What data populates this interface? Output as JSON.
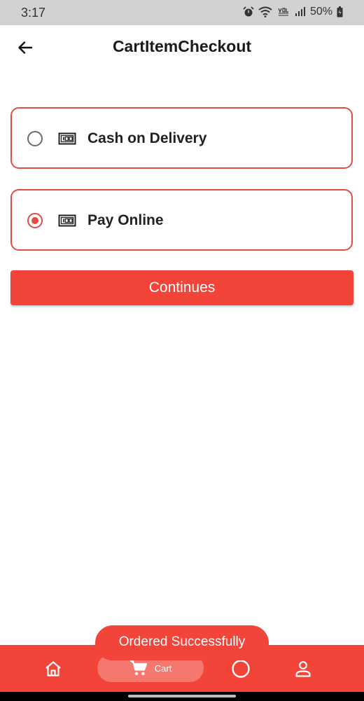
{
  "status_bar": {
    "time": "3:17",
    "battery": "50%",
    "icons": [
      "alarm-icon",
      "wifi-icon",
      "volte-icon",
      "signal-icon",
      "battery-icon"
    ]
  },
  "app_bar": {
    "title": "CartItemCheckout",
    "back_icon": "arrow-back-icon"
  },
  "payment_options": [
    {
      "label": "Cash on Delivery",
      "selected": false,
      "icon": "money-icon"
    },
    {
      "label": "Pay Online",
      "selected": true,
      "icon": "money-icon"
    }
  ],
  "continue_button": {
    "label": "Continues"
  },
  "toast": {
    "message": "Ordered Successfully"
  },
  "bottom_nav": {
    "items": [
      {
        "icon": "home-icon",
        "label": ""
      },
      {
        "icon": "cart-icon",
        "label": "Cart",
        "active": true
      },
      {
        "icon": "circle-icon",
        "label": ""
      },
      {
        "icon": "person-icon",
        "label": ""
      }
    ]
  },
  "colors": {
    "accent": "#f24438",
    "card_border": "#e24c44",
    "status_bar": "#d2d2d2"
  }
}
